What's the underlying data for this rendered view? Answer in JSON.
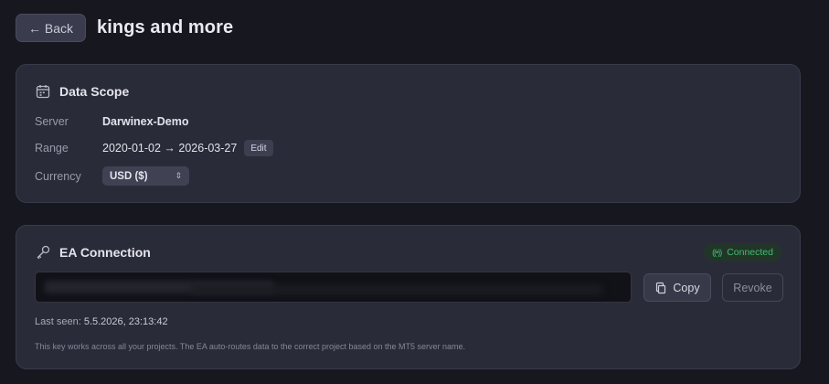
{
  "header": {
    "back_label": "← Back",
    "title": "kings and more"
  },
  "data_scope": {
    "title": "Data Scope",
    "server_label": "Server",
    "server_value": "Darwinex-Demo",
    "range_label": "Range",
    "range_value": "2020-01-02 → 2026-03-27",
    "edit_label": "Edit",
    "currency_label": "Currency",
    "currency_value": "USD ($)"
  },
  "ea_connection": {
    "title": "EA Connection",
    "status": "Connected",
    "status_color": "#3fbf6e",
    "copy_label": "Copy",
    "revoke_label": "Revoke",
    "last_seen_label": "Last seen:",
    "last_seen_value": "5.5.2026, 23:13:42",
    "hint": "This key works across all your projects. The EA auto-routes data to the correct project based on the MT5 server name."
  },
  "icons": {
    "data_scope": "calendar-icon",
    "ea_connection": "key-icon",
    "status": "signal-icon",
    "copy": "copy-icon",
    "currency_select": "chevron-updown-icon"
  }
}
